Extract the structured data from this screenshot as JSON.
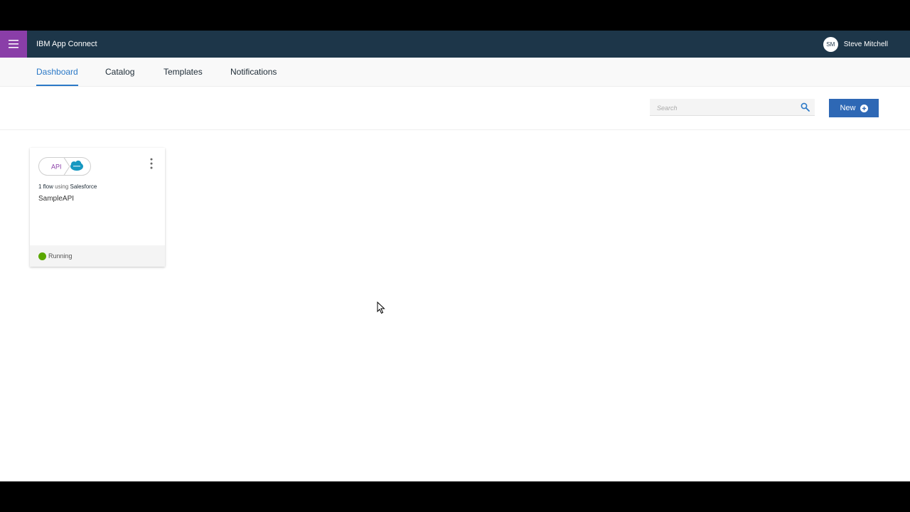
{
  "header": {
    "app_title": "IBM App Connect",
    "user_initials": "SM",
    "user_name": "Steve Mitchell",
    "background_color": "#1d3649",
    "menu_color": "#8a3ea8"
  },
  "tabs": [
    {
      "label": "Dashboard",
      "active": true
    },
    {
      "label": "Catalog",
      "active": false
    },
    {
      "label": "Templates",
      "active": false
    },
    {
      "label": "Notifications",
      "active": false
    }
  ],
  "toolbar": {
    "search_placeholder": "Search",
    "new_label": "New",
    "accent_color": "#2e68b5"
  },
  "card": {
    "source_chip": "API",
    "target_icon": "salesforce-cloud-icon",
    "flow_count": "1 flow",
    "flow_using": "using",
    "connector": "Salesforce",
    "name": "SampleAPI",
    "status": "Running",
    "status_color": "#5aa700"
  }
}
